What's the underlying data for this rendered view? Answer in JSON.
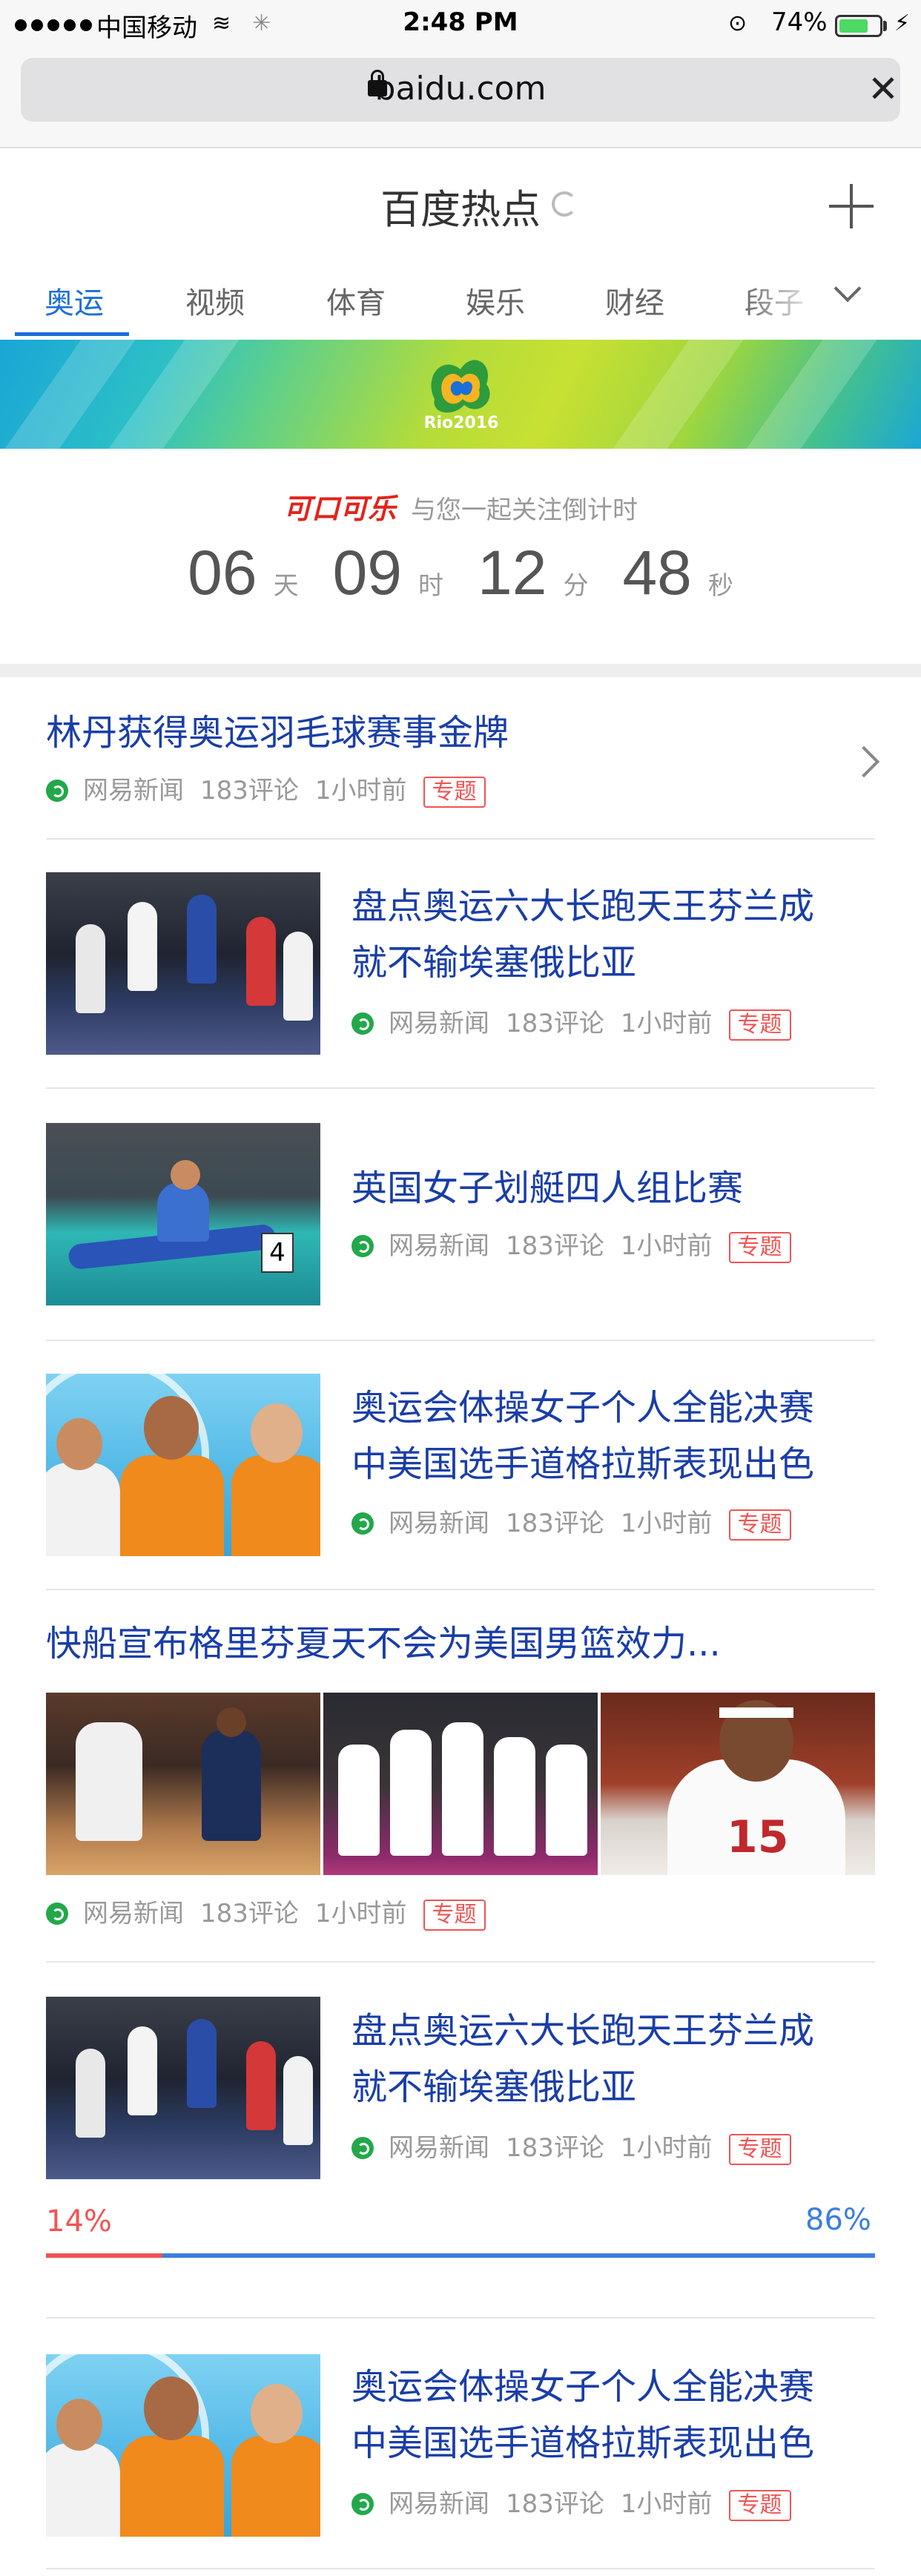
{
  "status_bar": {
    "carrier": "中国移动",
    "time": "2:48 PM",
    "battery": "74%",
    "battery_level": 0.74
  },
  "address_bar": {
    "url": "baidu.com",
    "close_icon": "close-icon"
  },
  "header": {
    "title": "百度热点",
    "add_icon": "plus-icon"
  },
  "tabs": [
    {
      "label": "奥运",
      "active": true
    },
    {
      "label": "视频",
      "active": false
    },
    {
      "label": "体育",
      "active": false
    },
    {
      "label": "娱乐",
      "active": false
    },
    {
      "label": "财经",
      "active": false
    },
    {
      "label": "段子",
      "active": false
    }
  ],
  "banner": {
    "logo_text": "Rio2016"
  },
  "countdown": {
    "sponsor": "可口可乐",
    "caption": "与您一起关注倒计时",
    "days": "06",
    "days_unit": "天",
    "hours": "09",
    "hours_unit": "时",
    "minutes": "12",
    "minutes_unit": "分",
    "seconds": "48",
    "seconds_unit": "秒"
  },
  "meta_common": {
    "source": "网易新闻",
    "comments": "183评论",
    "time": "1小时前",
    "badge": "专题"
  },
  "news": [
    {
      "title": "林丹获得奥运羽毛球赛事金牌"
    },
    {
      "title_line1": "盘点奥运六大长跑天王芬兰成",
      "title_line2": "就不输埃塞俄比亚"
    },
    {
      "title": "英国女子划艇四人组比赛"
    },
    {
      "title_line1": "奥运会体操女子个人全能决赛",
      "title_line2": "中美国选手道格拉斯表现出色"
    },
    {
      "title": "快船宣布格里芬夏天不会为美国男篮效力..."
    },
    {
      "title_line1": "盘点奥运六大长跑天王芬兰成",
      "title_line2": "就不输埃塞俄比亚"
    },
    {
      "title_line1": "奥运会体操女子个人全能决赛",
      "title_line2": "中美国选手道格拉斯表现出色"
    }
  ],
  "vote": {
    "left": "14%",
    "right": "86%",
    "left_fraction": 0.14
  },
  "colors": {
    "accent": "#1c6fd7",
    "title_blue": "#1a3ea8",
    "badge_red": "#f05454",
    "vote_blue": "#3d7ede"
  }
}
